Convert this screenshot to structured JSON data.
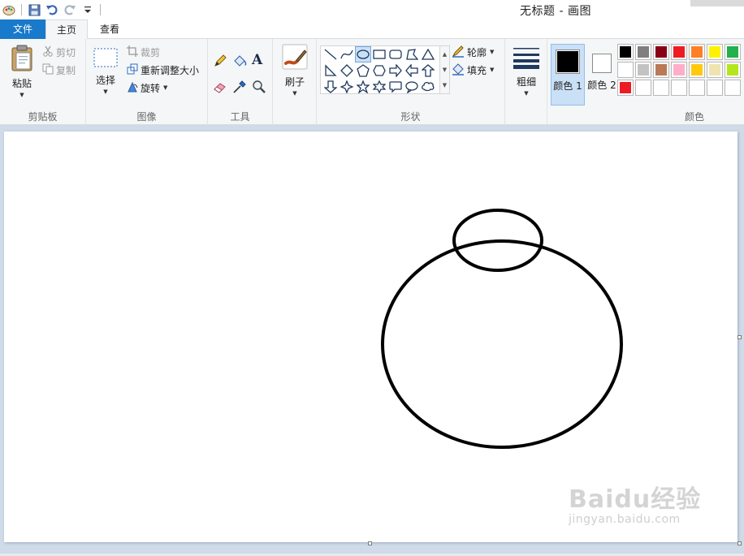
{
  "window": {
    "title": "无标题 - 画图"
  },
  "tabs": [
    {
      "label": "文件"
    },
    {
      "label": "主页"
    },
    {
      "label": "查看"
    }
  ],
  "clipboard": {
    "paste_label": "粘贴",
    "cut_label": "剪切",
    "copy_label": "复制",
    "group_label": "剪贴板"
  },
  "image": {
    "select_label": "选择",
    "crop_label": "裁剪",
    "resize_label": "重新调整大小",
    "rotate_label": "旋转",
    "group_label": "图像"
  },
  "tools": {
    "group_label": "工具",
    "text_glyph": "A"
  },
  "brushes": {
    "label": "刷子"
  },
  "shapes": {
    "outline_label": "轮廓",
    "fill_label": "填充",
    "group_label": "形状",
    "selected": "oval"
  },
  "size": {
    "label": "粗细"
  },
  "colors": {
    "color1_label": "颜色 1",
    "color2_label": "颜色 2",
    "group_label": "颜色",
    "color1": "#000000",
    "color2": "#ffffff",
    "palette": [
      "#000000",
      "#7f7f7f",
      "#880015",
      "#ed1c24",
      "#ff7f27",
      "#fff200",
      "#22b14c",
      "#ffffff",
      "#c3c3c3",
      "#b97a57",
      "#ffaec9",
      "#ffc90e",
      "#efe4b0",
      "#b5e61d",
      "#ed1c24",
      "#ffffff",
      "#ffffff",
      "#ffffff",
      "#ffffff",
      "#ffffff",
      "#ffffff"
    ]
  },
  "watermark": {
    "brand": "Baidu经验",
    "url": "jingyan.baidu.com"
  }
}
